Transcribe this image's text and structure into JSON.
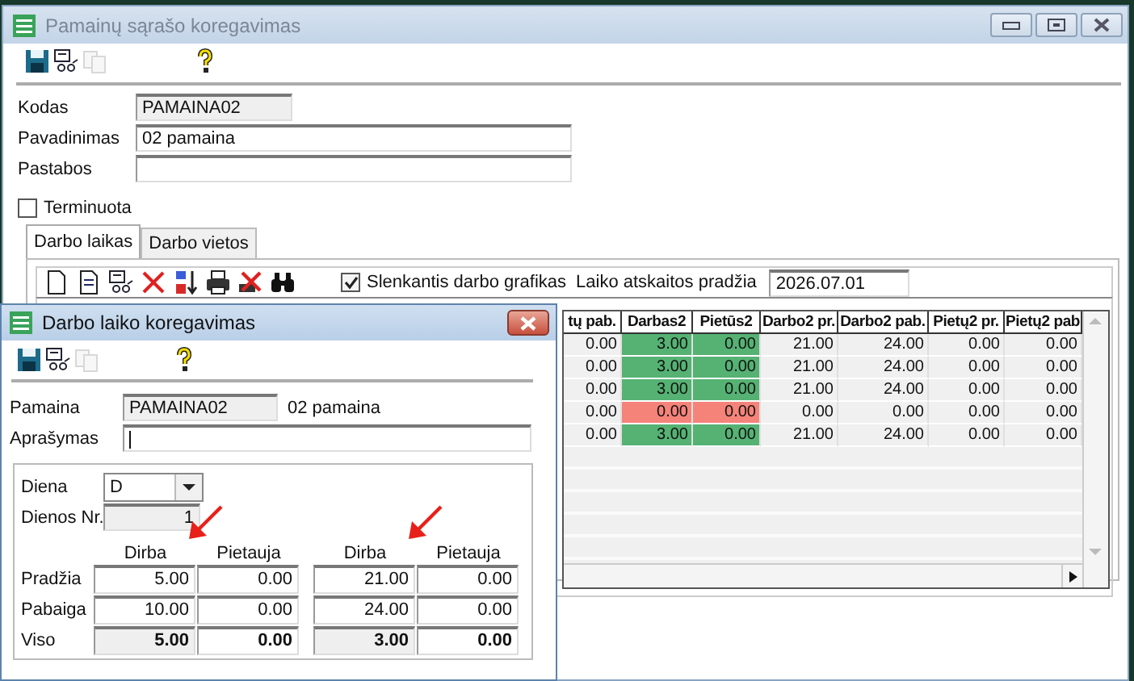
{
  "main_window": {
    "title": "Pamainų sąrašo koregavimas",
    "toolbar": [
      {
        "kind": "save",
        "disabled": false
      },
      {
        "kind": "tool",
        "disabled": false
      },
      {
        "kind": "copy",
        "disabled": true
      },
      {
        "kind": "help",
        "disabled": false
      }
    ],
    "fields": [
      {
        "label": "Kodas",
        "value": "PAMAINA02",
        "readonly": true
      },
      {
        "label": "Pavadinimas",
        "value": "02 pamaina",
        "readonly": false
      },
      {
        "label": "Pastabos",
        "readonly": false
      }
    ],
    "terminuota": {
      "label": "Terminuota",
      "checked": false
    },
    "tabs": [
      {
        "label": "Darbo laikas",
        "selected": true
      },
      {
        "label": "Darbo vietos",
        "selected": false
      }
    ],
    "grid_toolbar": [
      {
        "kind": "new"
      },
      {
        "kind": "edit"
      },
      {
        "kind": "tool"
      },
      {
        "kind": "delete"
      },
      {
        "kind": "sort"
      },
      {
        "kind": "print"
      },
      {
        "kind": "clear"
      },
      {
        "kind": "find"
      }
    ],
    "rolling_schedule": {
      "label": "Slenkantis darbo grafikas",
      "checked": true
    },
    "start_date": {
      "label": "Laiko atskaitos pradžia",
      "value": "2026.07.01"
    },
    "table": {
      "columns": [
        "tų pab.",
        "Darbas2",
        "Pietūs2",
        "Darbo2 pr.",
        "Darbo2 pab.",
        "Pietų2 pr.",
        "Pietų2 pab"
      ],
      "rows": [
        {
          "color": "#55b273",
          "cells": [
            "0.00",
            "3.00",
            "0.00",
            "21.00",
            "24.00",
            "0.00",
            "0.00"
          ]
        },
        {
          "color": "#55b273",
          "cells": [
            "0.00",
            "3.00",
            "0.00",
            "21.00",
            "24.00",
            "0.00",
            "0.00"
          ]
        },
        {
          "color": "#55b273",
          "cells": [
            "0.00",
            "3.00",
            "0.00",
            "21.00",
            "24.00",
            "0.00",
            "0.00"
          ]
        },
        {
          "color": "#f5837a",
          "cells": [
            "0.00",
            "0.00",
            "0.00",
            "0.00",
            "0.00",
            "0.00",
            "0.00"
          ]
        },
        {
          "color": "#55b273",
          "cells": [
            "0.00",
            "3.00",
            "0.00",
            "21.00",
            "24.00",
            "0.00",
            "0.00"
          ]
        }
      ]
    }
  },
  "dialog": {
    "title": "Darbo laiko koregavimas",
    "toolbar": [
      {
        "kind": "save",
        "disabled": false
      },
      {
        "kind": "tool",
        "disabled": false
      },
      {
        "kind": "copy",
        "disabled": true
      },
      {
        "kind": "help",
        "disabled": false
      }
    ],
    "pamaina": {
      "label": "Pamaina",
      "code": "PAMAINA02",
      "name": "02 pamaina"
    },
    "aprasymas": {
      "label": "Aprašymas"
    },
    "diena": {
      "label": "Diena",
      "value": "D"
    },
    "dienos_nr": {
      "label": "Dienos Nr.",
      "value": "1"
    },
    "column_groups": [
      {
        "headers": [
          "Dirba",
          "Pietauja"
        ],
        "arrow": true
      },
      {
        "headers": [
          "Dirba",
          "Pietauja"
        ],
        "arrow": true
      }
    ],
    "rows": [
      {
        "label": "Pradžia",
        "kind": "input",
        "values": [
          "5.00",
          "0.00",
          "21.00",
          "0.00"
        ]
      },
      {
        "label": "Pabaiga",
        "kind": "input",
        "values": [
          "10.00",
          "0.00",
          "24.00",
          "0.00"
        ]
      },
      {
        "label": "Viso",
        "kind": "total",
        "values": [
          "5.00",
          "0.00",
          "3.00",
          "0.00"
        ]
      }
    ]
  }
}
